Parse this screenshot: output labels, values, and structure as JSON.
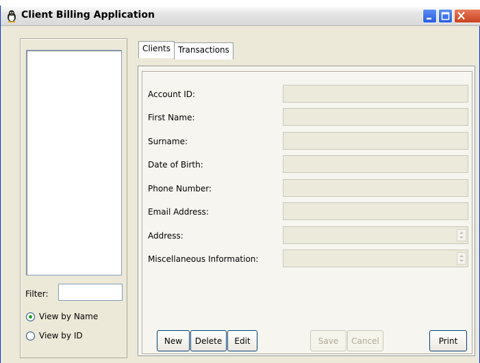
{
  "window": {
    "title": "Client Billing Application",
    "buttons": {
      "minimize": "minimize",
      "maximize": "maximize",
      "close": "close"
    }
  },
  "sidebar": {
    "filter_label": "Filter:",
    "filter_value": "",
    "view_options": [
      {
        "label": "View by Name",
        "selected": true
      },
      {
        "label": "View by ID",
        "selected": false
      }
    ]
  },
  "tabs": [
    {
      "label": "Clients",
      "active": true
    },
    {
      "label": "Transactions",
      "active": false
    }
  ],
  "form": {
    "fields": [
      {
        "label": "Account ID:",
        "value": ""
      },
      {
        "label": "First Name:",
        "value": ""
      },
      {
        "label": "Surname:",
        "value": ""
      },
      {
        "label": "Date of Birth:",
        "value": ""
      },
      {
        "label": "Phone Number:",
        "value": ""
      },
      {
        "label": "Email Address:",
        "value": ""
      },
      {
        "label": "Address:",
        "value": ""
      },
      {
        "label": "Miscellaneous Information:",
        "value": ""
      }
    ]
  },
  "actions": {
    "new": "New",
    "delete": "Delete",
    "edit": "Edit",
    "save": "Save",
    "cancel": "Cancel",
    "print": "Print"
  },
  "colors": {
    "window_bg": "#ece9d8",
    "title_bar": "#e6e6e6",
    "close_button": "#c8421f",
    "disabled_text": "#aca899",
    "radio_selected": "#21a121"
  }
}
